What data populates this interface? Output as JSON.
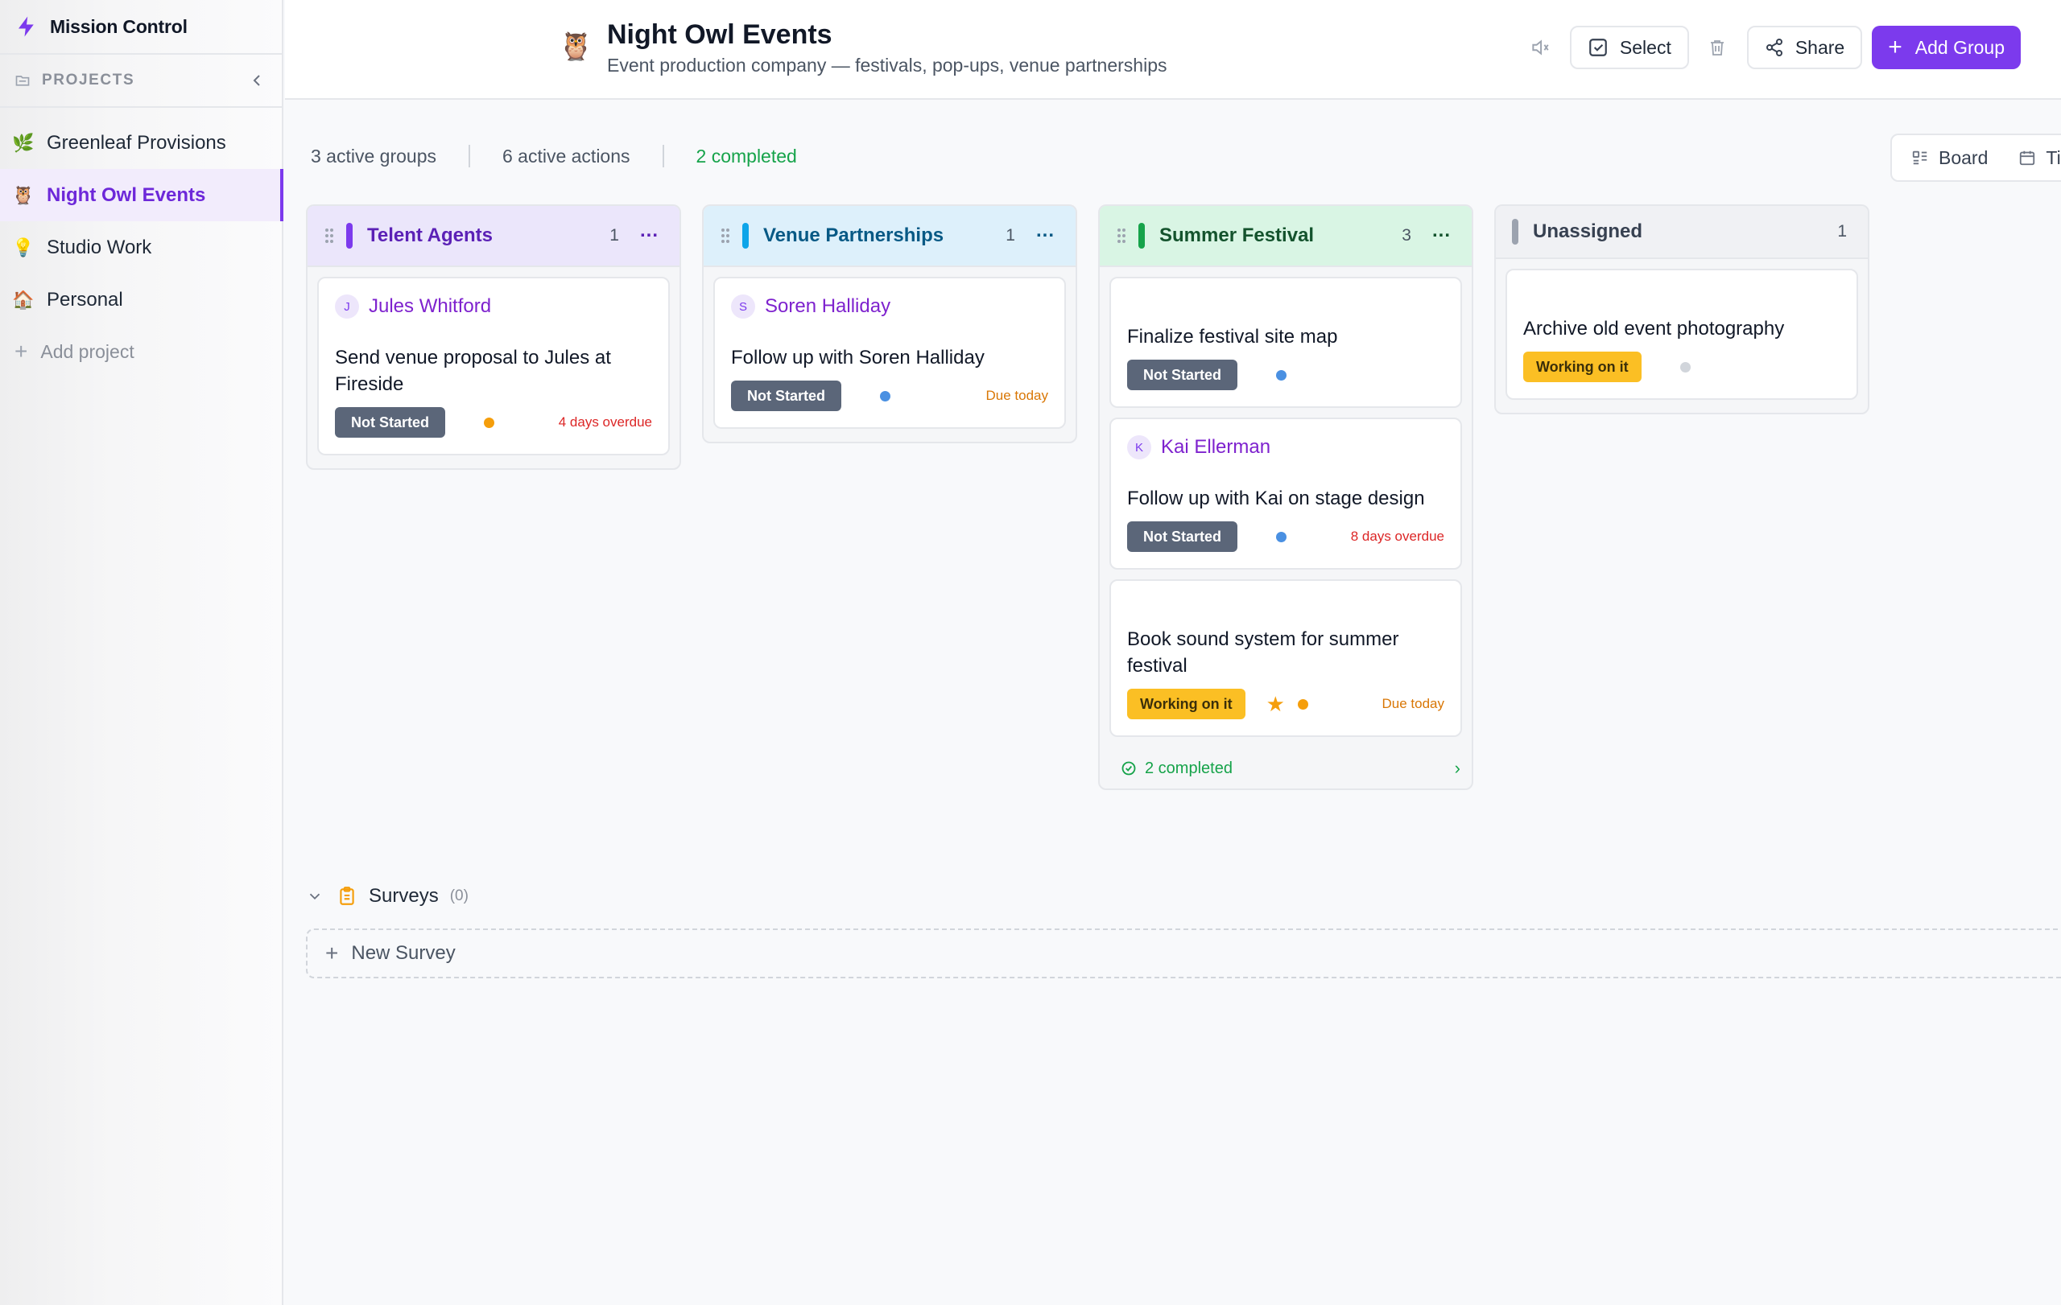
{
  "app": {
    "name": "Mission Control"
  },
  "sidebar": {
    "section_label": "PROJECTS",
    "projects": [
      {
        "label": "Greenleaf Provisions",
        "icon": "🌿",
        "active": false
      },
      {
        "label": "Night Owl Events",
        "icon": "🦉",
        "active": true
      },
      {
        "label": "Studio Work",
        "icon": "💡",
        "active": false
      },
      {
        "label": "Personal",
        "icon": "🏠",
        "active": false
      }
    ],
    "add_project_label": "Add project"
  },
  "header": {
    "icon": "🦉",
    "title": "Night Owl Events",
    "subtitle": "Event production company — festivals, pop-ups, venue partnerships",
    "select_label": "Select",
    "share_label": "Share",
    "add_group_label": "Add Group"
  },
  "stats": {
    "active_groups": "3 active groups",
    "active_actions": "6 active actions",
    "completed": "2 completed"
  },
  "view_toggle": {
    "board": "Board",
    "timeline": "Ti"
  },
  "colors": {
    "accent": "#7c3aed",
    "talent": "#7c3aed",
    "venue": "#0ea5e9",
    "summer": "#16a34a",
    "unassigned": "#9ca3af",
    "overdue": "#dc2626",
    "due_today": "#d97706"
  },
  "columns": [
    {
      "name": "Telent Agents",
      "count": "1",
      "cards": [
        {
          "avatar": "J",
          "contact": "Jules Whitford",
          "task": "Send venue proposal to Jules at Fireside",
          "status": "Not Started",
          "dot": "#f59e0b",
          "due": "4 days overdue"
        }
      ]
    },
    {
      "name": "Venue Partnerships",
      "count": "1",
      "cards": [
        {
          "avatar": "S",
          "contact": "Soren Halliday",
          "task": "Follow up with Soren Halliday",
          "status": "Not Started",
          "dot": "#4a90e2",
          "due": "Due today"
        }
      ]
    },
    {
      "name": "Summer Festival",
      "count": "3",
      "completed_label": "2 completed",
      "cards": [
        {
          "task": "Finalize festival site map",
          "status": "Not Started",
          "dot": "#4a90e2"
        },
        {
          "avatar": "K",
          "contact": "Kai Ellerman",
          "task": "Follow up with Kai on stage design",
          "status": "Not Started",
          "dot": "#4a90e2",
          "due": "8 days overdue"
        },
        {
          "task": "Book sound system for summer festival",
          "status": "Working on it",
          "starred": true,
          "dot": "#f59e0b",
          "due": "Due today"
        }
      ]
    },
    {
      "name": "Unassigned",
      "count": "1",
      "cards": [
        {
          "task": "Archive old event photography",
          "status": "Working on it",
          "dot": "#d1d5db"
        }
      ]
    }
  ],
  "surveys": {
    "label": "Surveys",
    "count": "(0)",
    "new_label": "New Survey"
  }
}
